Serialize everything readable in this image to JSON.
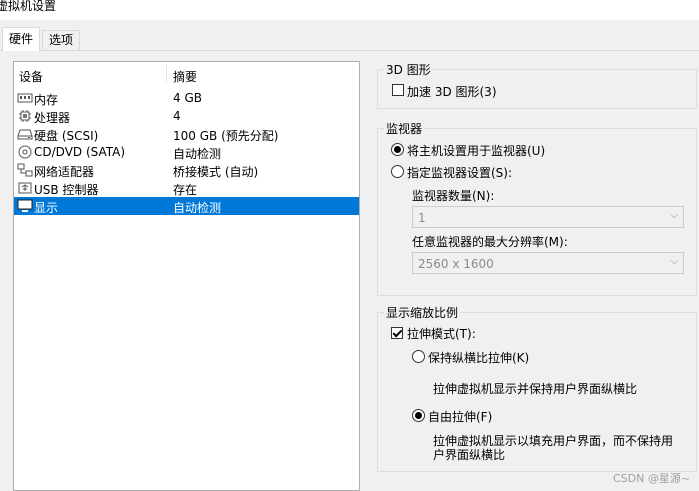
{
  "window": {
    "title": "虚拟机设置"
  },
  "tabs": [
    {
      "label": "硬件"
    },
    {
      "label": "选项"
    }
  ],
  "device_list": {
    "columns": {
      "device": "设备",
      "summary": "摘要"
    },
    "items": [
      {
        "name": "内存",
        "summary": "4 GB",
        "icon": "memory-icon"
      },
      {
        "name": "处理器",
        "summary": "4",
        "icon": "cpu-icon"
      },
      {
        "name": "硬盘 (SCSI)",
        "summary": "100 GB (预先分配)",
        "icon": "hard-disk-icon"
      },
      {
        "name": "CD/DVD (SATA)",
        "summary": "自动检测",
        "icon": "cd-dvd-icon"
      },
      {
        "name": "网络适配器",
        "summary": "桥接模式 (自动)",
        "icon": "network-adapter-icon"
      },
      {
        "name": "USB 控制器",
        "summary": "存在",
        "icon": "usb-icon"
      },
      {
        "name": "显示",
        "summary": "自动检测",
        "icon": "display-icon",
        "selected": true
      }
    ]
  },
  "graphics_3d": {
    "title": "3D 图形",
    "accelerate_label": "加速 3D 图形(3)",
    "accelerate_checked": false
  },
  "monitors": {
    "title": "监视器",
    "use_host_label": "将主机设置用于监视器(U)",
    "use_host_selected": true,
    "specify_label": "指定监视器设置(S):",
    "specify_selected": false,
    "count_label": "监视器数量(N):",
    "count_value": "1",
    "max_res_label": "任意监视器的最大分辨率(M):",
    "max_res_value": "2560 x 1600"
  },
  "scaling": {
    "title": "显示缩放比例",
    "stretch_label": "拉伸模式(T):",
    "stretch_checked": true,
    "keep_aspect_label": "保持纵横比拉伸(K)",
    "keep_aspect_selected": false,
    "keep_aspect_desc": "拉伸虚拟机显示并保持用户界面纵横比",
    "free_label": "自由拉伸(F)",
    "free_selected": true,
    "free_desc_1": "拉伸虚拟机显示以填充用户界面，而不保持用",
    "free_desc_2": "户界面纵横比"
  },
  "watermark": "CSDN @星源~"
}
